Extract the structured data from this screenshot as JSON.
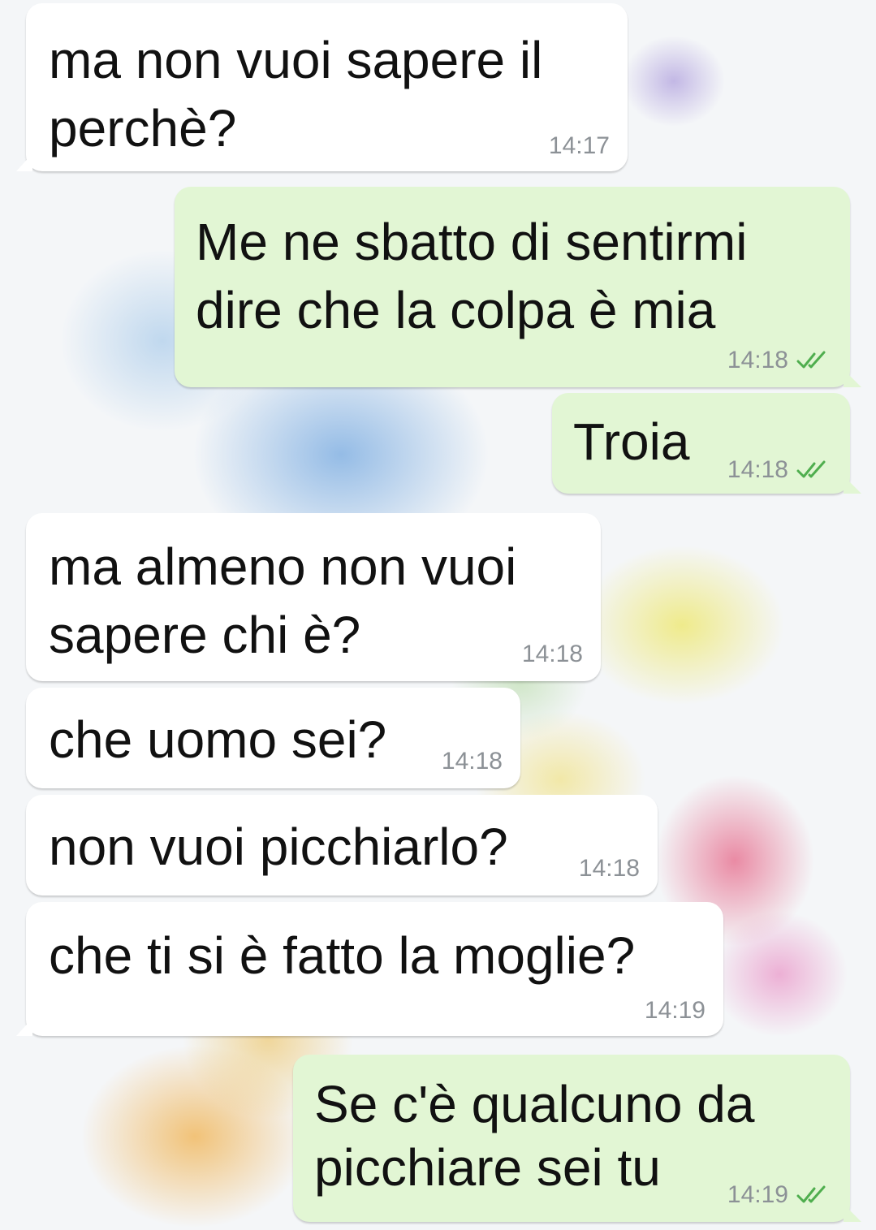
{
  "chat": {
    "messages": [
      {
        "direction": "in",
        "text_lines": [
          "ma non vuoi sapere il",
          "perchè?"
        ],
        "time": "14:17"
      },
      {
        "direction": "out",
        "text_lines": [
          "Me ne sbatto di sentirmi",
          "dire che la colpa è mia"
        ],
        "time": "14:18",
        "status": "read-double-check-icon"
      },
      {
        "direction": "out",
        "text_lines": [
          "Troia"
        ],
        "time": "14:18",
        "status": "read-double-check-icon"
      },
      {
        "direction": "in",
        "text_lines": [
          "ma almeno non vuoi",
          "sapere chi è?"
        ],
        "time": "14:18"
      },
      {
        "direction": "in",
        "text_lines": [
          "che uomo sei?"
        ],
        "time": "14:18"
      },
      {
        "direction": "in",
        "text_lines": [
          "non vuoi picchiarlo?"
        ],
        "time": "14:18"
      },
      {
        "direction": "in",
        "text_lines": [
          "che ti si è fatto la moglie?"
        ],
        "time": "14:19"
      },
      {
        "direction": "out",
        "text_lines": [
          "Se c'è qualcuno da",
          "picchiare sei tu"
        ],
        "time": "14:19",
        "status": "read-double-check-icon"
      }
    ]
  },
  "colors": {
    "incoming_bubble": "#ffffff",
    "outgoing_bubble": "#e2f6d4",
    "time_text": "#8c9196",
    "read_ticks": "#4fae4e"
  }
}
